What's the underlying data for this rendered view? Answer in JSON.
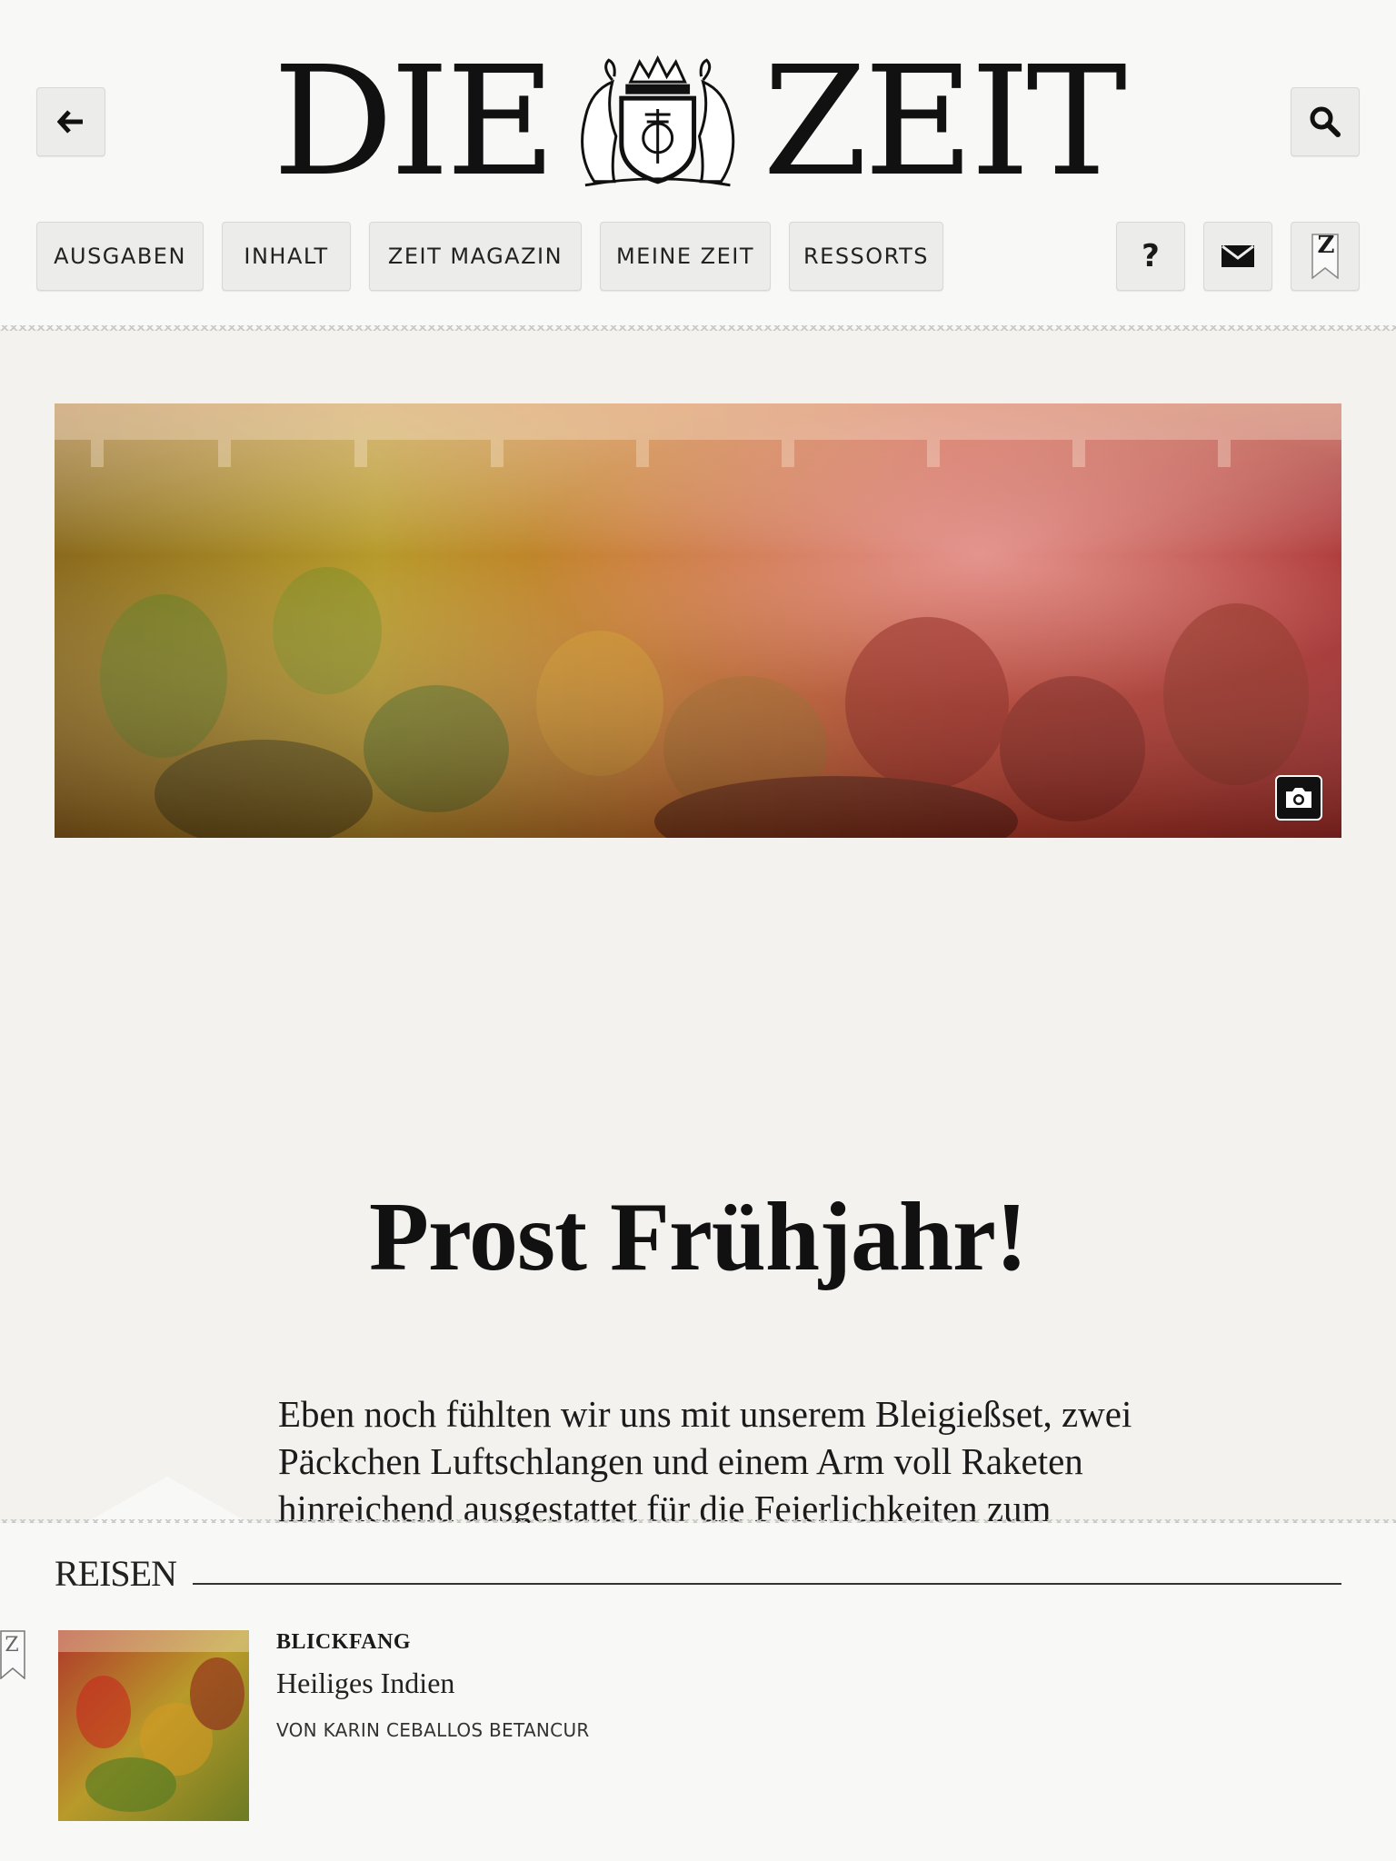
{
  "header": {
    "logo_left": "DIE",
    "logo_right": "ZEIT",
    "nav": [
      "AUSGABEN",
      "INHALT",
      "ZEIT MAGAZIN",
      "MEINE ZEIT",
      "RESSORTS"
    ],
    "help_label": "?",
    "bookmark_label": "Z",
    "icons": {
      "back": "arrow-left-icon",
      "search": "search-icon",
      "mail": "mail-icon",
      "bookmark": "bookmark-icon",
      "camera": "camera-icon"
    }
  },
  "article": {
    "headline": "Prost Frühjahr!",
    "lead": "Eben noch fühlten wir uns mit unserem Bleigießset, zwei Päckchen Luftschlangen und einem Arm voll Raketen hinreichend ausgestattet für die Feierlichkeiten zum"
  },
  "section": {
    "label": "REISEN",
    "item": {
      "kicker": "BLICKFANG",
      "title": "Heiliges Indien",
      "byline": "VON KARIN CEBALLOS BETANCUR",
      "bookmark_label": "Z"
    }
  }
}
